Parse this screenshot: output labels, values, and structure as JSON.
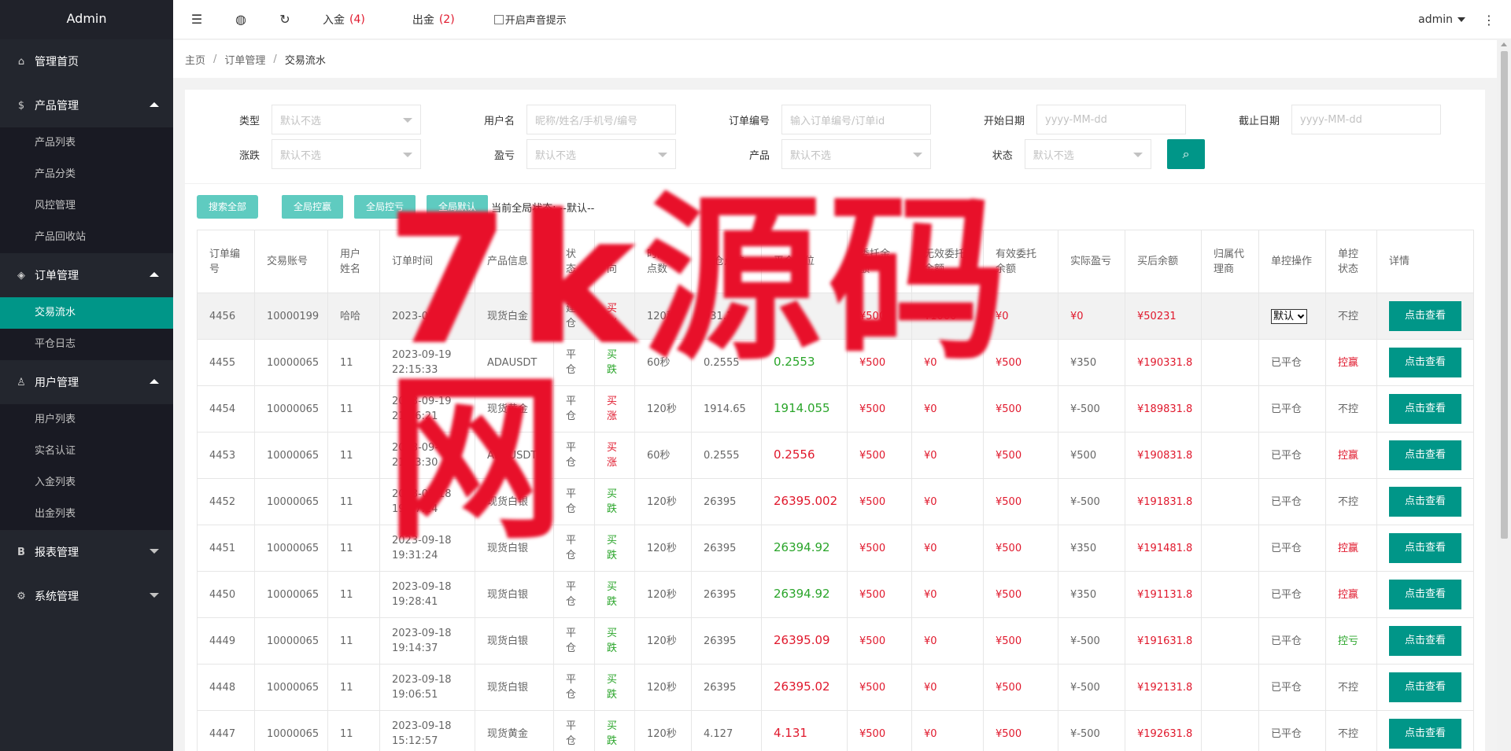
{
  "sidebar": {
    "brand": "Admin",
    "items": [
      {
        "label": "管理首页",
        "icon": "home-icon"
      },
      {
        "label": "产品管理",
        "icon": "dollar-icon",
        "children": [
          "产品列表",
          "产品分类",
          "风控管理",
          "产品回收站"
        ]
      },
      {
        "label": "订单管理",
        "icon": "layers-icon",
        "children": [
          "交易流水",
          "平仓日志"
        ],
        "active_child": "交易流水"
      },
      {
        "label": "用户管理",
        "icon": "user-icon",
        "children": [
          "用户列表",
          "实名认证",
          "入金列表",
          "出金列表"
        ]
      },
      {
        "label": "报表管理",
        "icon": "bold-b-icon"
      },
      {
        "label": "系统管理",
        "icon": "gear-icon"
      }
    ]
  },
  "topbar": {
    "deposit_label": "入金",
    "deposit_count": "(4)",
    "withdraw_label": "出金",
    "withdraw_count": "(2)",
    "sound_label": "开启声音提示",
    "user": "admin",
    "more": "⋮"
  },
  "breadcrumb": [
    "主页",
    "订单管理",
    "交易流水"
  ],
  "filters": {
    "type_label": "类型",
    "type_placeholder": "默认不选",
    "username_label": "用户名",
    "username_placeholder": "昵称/姓名/手机号/编号",
    "order_label": "订单编号",
    "order_placeholder": "输入订单编号/订单id",
    "start_label": "开始日期",
    "start_placeholder": "yyyy-MM-dd",
    "end_label": "截止日期",
    "end_placeholder": "yyyy-MM-dd",
    "updown_label": "涨跌",
    "updown_placeholder": "默认不选",
    "pl_label": "盈亏",
    "pl_placeholder": "默认不选",
    "product_label": "产品",
    "product_placeholder": "默认不选",
    "status_label": "状态",
    "status_placeholder": "默认不选"
  },
  "actions": {
    "search_all": "搜索全部",
    "global_win": "全局控赢",
    "global_lose": "全局控亏",
    "global_default": "全局默认",
    "state_text": "当前全局状态: --默认--"
  },
  "table": {
    "headers": [
      "订单编号",
      "交易账号",
      "用户姓名",
      "订单时间",
      "产品信息",
      "状态",
      "方向",
      "时间/点数",
      "建仓点位",
      "平仓点位",
      "委托余额",
      "无效委托余额",
      "有效委托余额",
      "实际盈亏",
      "买后余额",
      "归属代理商",
      "单控操作",
      "单控状态",
      "详情"
    ],
    "view_label": "点击查看",
    "select_default": "默认",
    "rows": [
      {
        "id": "4456",
        "account": "10000199",
        "name": "哈哈",
        "date": "2023-09-21",
        "time": "",
        "product": "现货白金",
        "status": "建仓",
        "dir": "买涨",
        "dur": "120秒",
        "open": "931.15",
        "close": "",
        "close_color": "red",
        "entrust": "¥500",
        "invalid": "¥1000",
        "valid": "¥0",
        "pl": "¥0",
        "after": "¥50231",
        "agent": "",
        "op": "select",
        "op_state": "不控",
        "op_state_color": "gray"
      },
      {
        "id": "4455",
        "account": "10000065",
        "name": "11",
        "date": "2023-09-19",
        "time": "22:15:33",
        "product": "ADAUSDT",
        "status": "平仓",
        "dir": "买跌",
        "dur": "60秒",
        "open": "0.2555",
        "close": "0.2553",
        "close_color": "green",
        "entrust": "¥500",
        "invalid": "¥0",
        "valid": "¥500",
        "pl": "¥350",
        "after": "¥190331.8",
        "agent": "",
        "op": "已平仓",
        "op_state": "控赢",
        "op_state_color": "red"
      },
      {
        "id": "4454",
        "account": "10000065",
        "name": "11",
        "date": "2023-09-19",
        "time": "21:56:21",
        "product": "现货黄金",
        "status": "平仓",
        "dir": "买涨",
        "dur": "120秒",
        "open": "1914.65",
        "close": "1914.055",
        "close_color": "green",
        "entrust": "¥500",
        "invalid": "¥0",
        "valid": "¥500",
        "pl": "¥-500",
        "after": "¥189831.8",
        "agent": "",
        "op": "已平仓",
        "op_state": "不控",
        "op_state_color": "gray"
      },
      {
        "id": "4453",
        "account": "10000065",
        "name": "11",
        "date": "2023-09-19",
        "time": "21:53:30",
        "product": "ADAUSDT",
        "status": "平仓",
        "dir": "买涨",
        "dur": "60秒",
        "open": "0.2555",
        "close": "0.2556",
        "close_color": "red",
        "entrust": "¥500",
        "invalid": "¥0",
        "valid": "¥500",
        "pl": "¥500",
        "after": "¥190831.8",
        "agent": "",
        "op": "已平仓",
        "op_state": "控赢",
        "op_state_color": "red"
      },
      {
        "id": "4452",
        "account": "10000065",
        "name": "11",
        "date": "2023-09-18",
        "time": "19:37:24",
        "product": "现货白银",
        "status": "平仓",
        "dir": "买跌",
        "dur": "120秒",
        "open": "26395",
        "close": "26395.002",
        "close_color": "red",
        "entrust": "¥500",
        "invalid": "¥0",
        "valid": "¥500",
        "pl": "¥-500",
        "after": "¥191831.8",
        "agent": "",
        "op": "已平仓",
        "op_state": "不控",
        "op_state_color": "gray"
      },
      {
        "id": "4451",
        "account": "10000065",
        "name": "11",
        "date": "2023-09-18",
        "time": "19:31:24",
        "product": "现货白银",
        "status": "平仓",
        "dir": "买跌",
        "dur": "120秒",
        "open": "26395",
        "close": "26394.92",
        "close_color": "green",
        "entrust": "¥500",
        "invalid": "¥0",
        "valid": "¥500",
        "pl": "¥350",
        "after": "¥191481.8",
        "agent": "",
        "op": "已平仓",
        "op_state": "控赢",
        "op_state_color": "red"
      },
      {
        "id": "4450",
        "account": "10000065",
        "name": "11",
        "date": "2023-09-18",
        "time": "19:28:41",
        "product": "现货白银",
        "status": "平仓",
        "dir": "买跌",
        "dur": "120秒",
        "open": "26395",
        "close": "26394.92",
        "close_color": "green",
        "entrust": "¥500",
        "invalid": "¥0",
        "valid": "¥500",
        "pl": "¥350",
        "after": "¥191131.8",
        "agent": "",
        "op": "已平仓",
        "op_state": "控赢",
        "op_state_color": "red"
      },
      {
        "id": "4449",
        "account": "10000065",
        "name": "11",
        "date": "2023-09-18",
        "time": "19:14:37",
        "product": "现货白银",
        "status": "平仓",
        "dir": "买跌",
        "dur": "120秒",
        "open": "26395",
        "close": "26395.09",
        "close_color": "red",
        "entrust": "¥500",
        "invalid": "¥0",
        "valid": "¥500",
        "pl": "¥-500",
        "after": "¥191631.8",
        "agent": "",
        "op": "已平仓",
        "op_state": "控亏",
        "op_state_color": "green"
      },
      {
        "id": "4448",
        "account": "10000065",
        "name": "11",
        "date": "2023-09-18",
        "time": "19:06:51",
        "product": "现货白银",
        "status": "平仓",
        "dir": "买跌",
        "dur": "120秒",
        "open": "26395",
        "close": "26395.02",
        "close_color": "red",
        "entrust": "¥500",
        "invalid": "¥0",
        "valid": "¥500",
        "pl": "¥-500",
        "after": "¥192131.8",
        "agent": "",
        "op": "已平仓",
        "op_state": "不控",
        "op_state_color": "gray"
      },
      {
        "id": "4447",
        "account": "10000065",
        "name": "11",
        "date": "2023-09-18",
        "time": "15:12:57",
        "product": "现货黄金",
        "status": "平仓",
        "dir": "买跌",
        "dur": "120秒",
        "open": "4.127",
        "close": "4.131",
        "close_color": "red",
        "entrust": "¥500",
        "invalid": "¥0",
        "valid": "¥500",
        "pl": "¥-500",
        "after": "¥192631.8",
        "agent": "",
        "op": "已平仓",
        "op_state": "不控",
        "op_state_color": "gray"
      }
    ]
  },
  "watermark": "7k源码网",
  "colors": {
    "accent": "#009688",
    "light_accent": "#5fcbc0",
    "red": "#e0182c",
    "green": "#2aa52a",
    "sidebar": "#23262e"
  }
}
